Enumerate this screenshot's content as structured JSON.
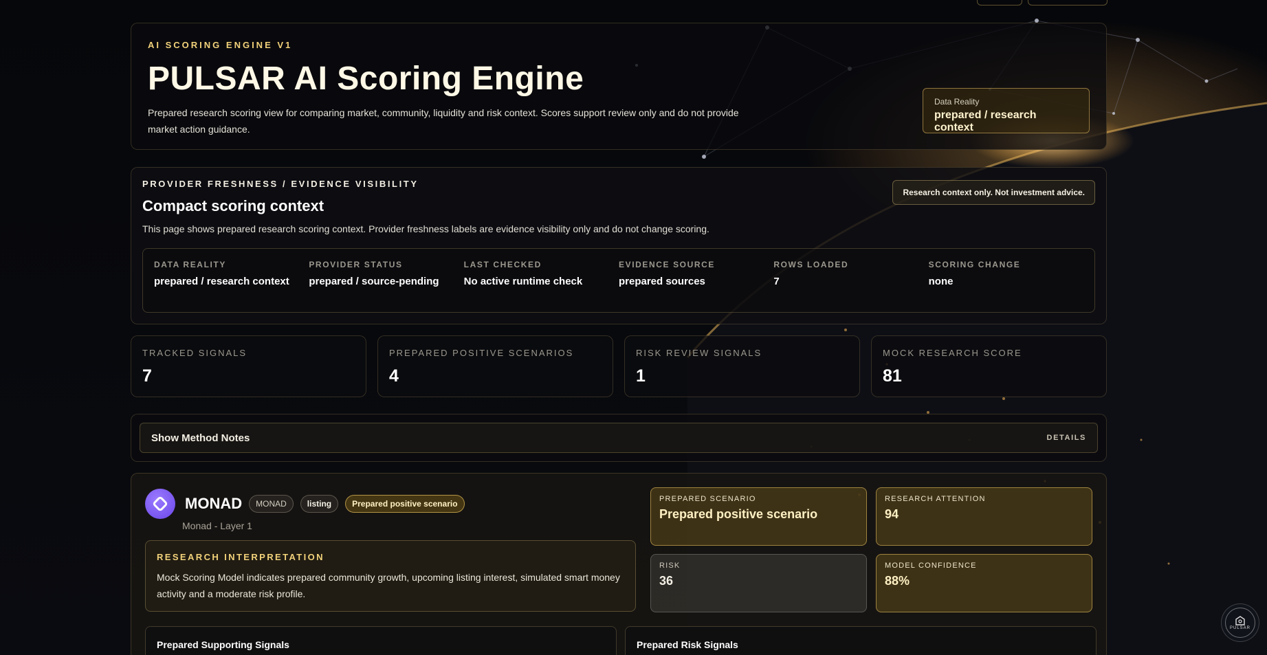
{
  "hero": {
    "eyebrow": "AI SCORING ENGINE V1",
    "title": "PULSAR AI Scoring Engine",
    "description": "Prepared research scoring view for comparing market, community, liquidity and risk context. Scores support review only and do not provide market action guidance.",
    "badge_label": "Data Reality",
    "badge_value": "prepared / research context"
  },
  "context": {
    "eyebrow": "PROVIDER FRESHNESS / EVIDENCE VISIBILITY",
    "title": "Compact scoring context",
    "description": "This page shows prepared research scoring context. Provider freshness labels are evidence visibility only and do not change scoring.",
    "advice": "Research context only. Not investment advice.",
    "facts": [
      {
        "label": "DATA REALITY",
        "value": "prepared / research context"
      },
      {
        "label": "PROVIDER STATUS",
        "value": "prepared / source-pending"
      },
      {
        "label": "LAST CHECKED",
        "value": "No active runtime check"
      },
      {
        "label": "EVIDENCE SOURCE",
        "value": "prepared sources"
      },
      {
        "label": "ROWS LOADED",
        "value": "7"
      },
      {
        "label": "SCORING CHANGE",
        "value": "none"
      }
    ]
  },
  "stats": [
    {
      "label": "TRACKED SIGNALS",
      "value": "7"
    },
    {
      "label": "PREPARED POSITIVE SCENARIOS",
      "value": "4"
    },
    {
      "label": "RISK REVIEW SIGNALS",
      "value": "1"
    },
    {
      "label": "MOCK RESEARCH SCORE",
      "value": "81"
    }
  ],
  "method": {
    "label": "Show Method Notes",
    "details": "DETAILS"
  },
  "coin": {
    "name": "MONAD",
    "ticker": "MONAD",
    "tag": "listing",
    "scenario_tag": "Prepared positive scenario",
    "subtitle": "Monad - Layer 1",
    "interp_eyebrow": "RESEARCH INTERPRETATION",
    "interp_text": "Mock Scoring Model indicates prepared community growth, upcoming listing interest, simulated smart money activity and a moderate risk profile.",
    "metrics": {
      "scenario": {
        "label": "PREPARED SCENARIO",
        "value": "Prepared positive scenario"
      },
      "attention": {
        "label": "RESEARCH ATTENTION",
        "value": "94"
      },
      "risk": {
        "label": "RISK",
        "value": "36"
      },
      "confidence": {
        "label": "MODEL CONFIDENCE",
        "value": "88%"
      }
    },
    "supporting_title": "Prepared Supporting Signals",
    "risk_title": "Prepared Risk Signals"
  },
  "assistant": {
    "label": "PULSAR"
  },
  "colors": {
    "accent": "#f2d27a",
    "gold_panel": "#5f4b19",
    "logo": "#7b5bf5"
  }
}
